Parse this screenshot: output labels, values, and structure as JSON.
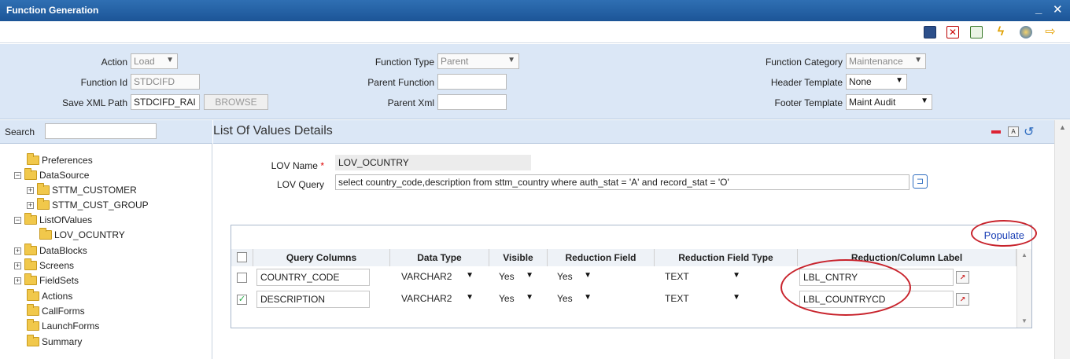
{
  "window": {
    "title": "Function Generation",
    "minimize": "_",
    "close": "✕"
  },
  "toolbar": {
    "icons": [
      "save-icon",
      "delete-icon",
      "list-icon",
      "generate-icon",
      "release-icon",
      "exit-icon"
    ]
  },
  "header": {
    "action": {
      "label": "Action",
      "value": "Load"
    },
    "function_id": {
      "label": "Function Id",
      "value": "STDCIFD"
    },
    "save_xml_path": {
      "label": "Save XML Path",
      "value": "STDCIFD_RAI",
      "browse": "BROWSE"
    },
    "function_type": {
      "label": "Function Type",
      "value": "Parent"
    },
    "parent_function": {
      "label": "Parent Function",
      "value": ""
    },
    "parent_xml": {
      "label": "Parent Xml",
      "value": ""
    },
    "function_category": {
      "label": "Function Category",
      "value": "Maintenance"
    },
    "header_template": {
      "label": "Header Template",
      "value": "None"
    },
    "footer_template": {
      "label": "Footer Template",
      "value": "Maint Audit"
    }
  },
  "sidebar": {
    "search_label": "Search",
    "search_value": "",
    "tree": [
      {
        "label": "Preferences",
        "toggle": ""
      },
      {
        "label": "DataSource",
        "toggle": "−"
      },
      {
        "label": "STTM_CUSTOMER",
        "toggle": "+"
      },
      {
        "label": "STTM_CUST_GROUP",
        "toggle": "+"
      },
      {
        "label": "ListOfValues",
        "toggle": "−"
      },
      {
        "label": "LOV_OCUNTRY",
        "toggle": ""
      },
      {
        "label": "DataBlocks",
        "toggle": "+"
      },
      {
        "label": "Screens",
        "toggle": "+"
      },
      {
        "label": "FieldSets",
        "toggle": "+"
      },
      {
        "label": "Actions",
        "toggle": ""
      },
      {
        "label": "CallForms",
        "toggle": ""
      },
      {
        "label": "LaunchForms",
        "toggle": ""
      },
      {
        "label": "Summary",
        "toggle": ""
      }
    ]
  },
  "main": {
    "title": "List Of Values Details",
    "lov_name": {
      "label": "LOV Name",
      "required": "*",
      "value": "LOV_OCUNTRY"
    },
    "lov_query": {
      "label": "LOV Query",
      "value": "select country_code,description from sttm_country where auth_stat = 'A' and record_stat = 'O'"
    },
    "populate": "Populate",
    "grid": {
      "columns": [
        "Query Columns",
        "Data Type",
        "Visible",
        "Reduction Field",
        "Reduction Field Type",
        "Reduction/Column Label"
      ],
      "rows": [
        {
          "checked": "",
          "query_column": "COUNTRY_CODE",
          "data_type": "VARCHAR2",
          "visible": "Yes",
          "reduction_field": "Yes",
          "reduction_field_type": "TEXT",
          "label": "LBL_CNTRY"
        },
        {
          "checked": "✓",
          "query_column": "DESCRIPTION",
          "data_type": "VARCHAR2",
          "visible": "Yes",
          "reduction_field": "Yes",
          "reduction_field_type": "TEXT",
          "label": "LBL_COUNTRYCD"
        }
      ]
    }
  },
  "colors": {
    "titlebar": "#1c5597",
    "panel": "#dbe7f6",
    "highlight_oval": "#c8232c",
    "link": "#1a3fb5"
  }
}
